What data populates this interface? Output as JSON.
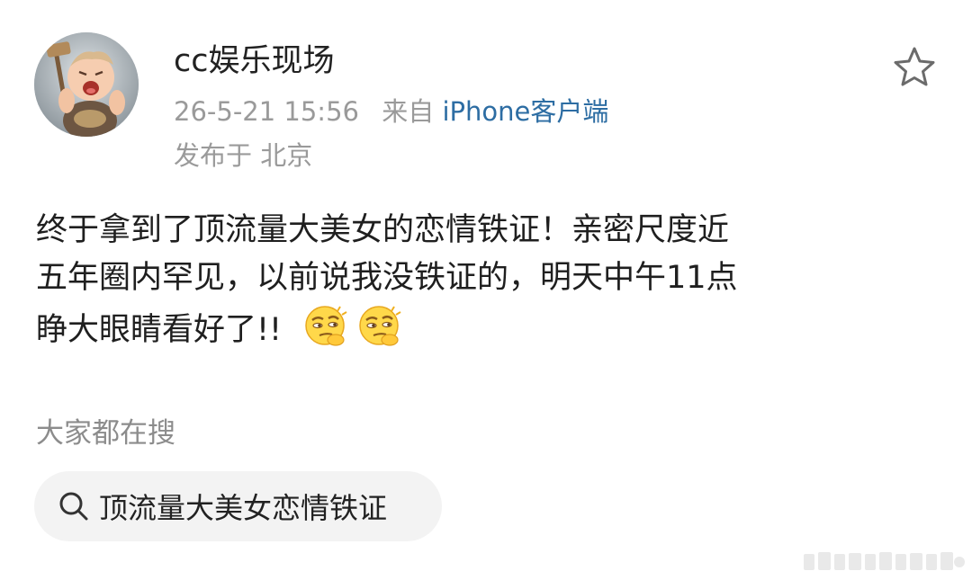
{
  "post": {
    "author": "cc娱乐现场",
    "timestamp": "26-5-21 15:56",
    "source_prefix": "来自",
    "source_device": "iPhone客户端",
    "location": "发布于 北京",
    "content_lines": [
      "终于拿到了顶流量大美女的恋情铁证！亲密尺度近",
      "五年圈内罕见，以前说我没铁证的，明天中午11点",
      "睁大眼睛看好了!!"
    ],
    "emojis": [
      "thinking-smirk-emoji",
      "thinking-smirk-emoji"
    ]
  },
  "icons": {
    "favorite": "star-icon",
    "search": "search-icon"
  },
  "trending": {
    "label": "大家都在搜",
    "query": "顶流量大美女恋情铁证"
  },
  "colors": {
    "link": "#2d6da3",
    "meta_text": "#9a9a9a",
    "chip_background": "#f3f3f3"
  }
}
